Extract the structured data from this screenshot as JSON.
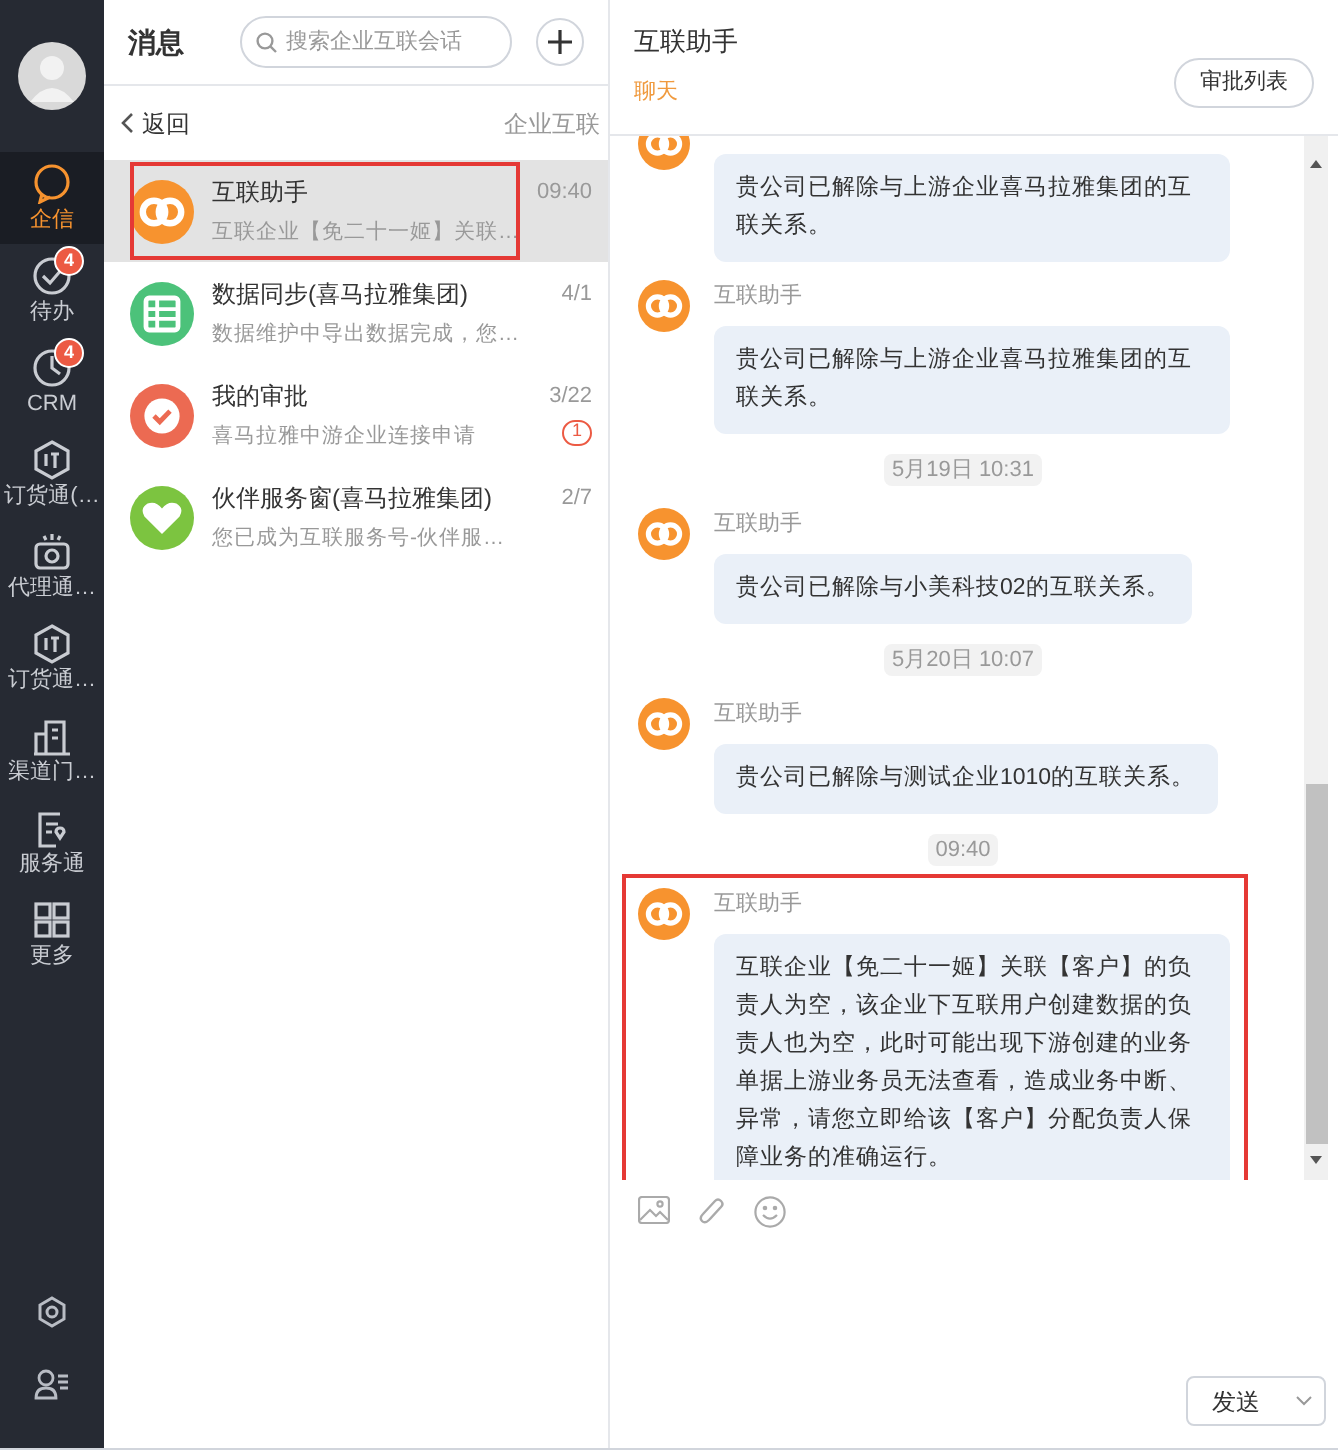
{
  "nav": {
    "items": [
      {
        "label": "企信",
        "selected": true
      },
      {
        "label": "待办",
        "selected": false,
        "badge": "4"
      },
      {
        "label": "CRM",
        "selected": false,
        "badge": "4"
      },
      {
        "label": "订货通(…",
        "selected": false
      },
      {
        "label": "代理通…",
        "selected": false
      },
      {
        "label": "订货通…",
        "selected": false
      },
      {
        "label": "渠道门…",
        "selected": false
      },
      {
        "label": "服务通",
        "selected": false
      },
      {
        "label": "更多",
        "selected": false
      }
    ]
  },
  "list": {
    "title": "消息",
    "search": {
      "placeholder": "搜索企业互联会话"
    },
    "back": "返回",
    "section": "企业互联",
    "conversations": [
      {
        "name": "互联助手",
        "preview": "互联企业【免二十一姬】关联…",
        "time": "09:40",
        "color": "#f7932f",
        "selected": true,
        "highlighted": true
      },
      {
        "name": "数据同步(喜马拉雅集团)",
        "preview": "数据维护中导出数据完成，您…",
        "time": "4/1",
        "color": "#4cc27a",
        "selected": false,
        "highlighted": false
      },
      {
        "name": "我的审批",
        "preview": "喜马拉雅中游企业连接申请",
        "time": "3/22",
        "color": "#ec6a52",
        "selected": false,
        "highlighted": false,
        "unread": "1"
      },
      {
        "name": "伙伴服务窗(喜马拉雅集团)",
        "preview": "您已成为互联服务号-伙伴服…",
        "time": "2/7",
        "color": "#7cc440",
        "selected": false,
        "highlighted": false
      }
    ]
  },
  "chat": {
    "title": "互联助手",
    "tab": "聊天",
    "approval_button": "审批列表",
    "send_button": "发送",
    "items": [
      {
        "kind": "message",
        "text": "贵公司已解除与上游企业喜马拉雅集团的互联关系。",
        "highlighted": false
      },
      {
        "kind": "message",
        "sender": "互联助手",
        "text": "贵公司已解除与上游企业喜马拉雅集团的互联关系。",
        "highlighted": false
      },
      {
        "kind": "time",
        "text": "5月19日 10:31"
      },
      {
        "kind": "message",
        "sender": "互联助手",
        "text": "贵公司已解除与小美科技02的互联关系。",
        "highlighted": false
      },
      {
        "kind": "time",
        "text": "5月20日 10:07"
      },
      {
        "kind": "message",
        "sender": "互联助手",
        "text": "贵公司已解除与测试企业1010的互联关系。",
        "highlighted": false
      },
      {
        "kind": "time",
        "text": "09:40"
      },
      {
        "kind": "message",
        "sender": "互联助手",
        "text": "互联企业【免二十一姬】关联【客户】的负责人为空，该企业下互联用户创建数据的负责人也为空，此时可能出现下游创建的业务单据上游业务员无法查看，造成业务中断、异常，请您立即给该【客户】分配负责人保障业务的准确运行。",
        "highlighted": true
      }
    ]
  }
}
